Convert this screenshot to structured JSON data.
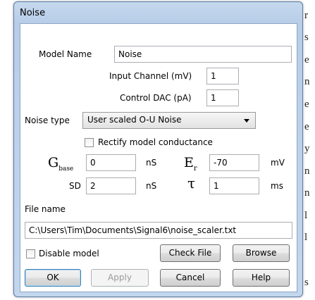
{
  "background_text": [
    "r",
    "s",
    "e",
    "n",
    "e",
    "e",
    "y",
    "n",
    "n",
    "l",
    "l",
    "s"
  ],
  "dialog": {
    "title": "Noise",
    "model_name_label": "Model Name",
    "model_name_value": "Noise",
    "input_channel_label": "Input Channel (mV)",
    "input_channel_value": "1",
    "control_dac_label": "Control DAC (pA)",
    "control_dac_value": "1",
    "noise_type_label": "Noise type",
    "noise_type_value": "User scaled O-U Noise",
    "rectify_label": "Rectify model conductance",
    "rectify_checked": false,
    "gbase_symbol": "G",
    "gbase_subscript": "base",
    "gbase_value": "0",
    "gbase_unit": "nS",
    "er_symbol": "E",
    "er_subscript": "r",
    "er_value": "-70",
    "er_unit": "mV",
    "sd_label": "SD",
    "sd_value": "2",
    "sd_unit": "nS",
    "tau_symbol": "τ",
    "tau_value": "1",
    "tau_unit": "ms",
    "file_name_label": "File name",
    "file_name_value": "C:\\Users\\Tim\\Documents\\Signal6\\noise_scaler.txt",
    "disable_label": "Disable model",
    "disable_checked": false,
    "buttons": {
      "check_file": "Check File",
      "browse": "Browse",
      "ok": "OK",
      "apply": "Apply",
      "cancel": "Cancel",
      "help": "Help"
    }
  }
}
